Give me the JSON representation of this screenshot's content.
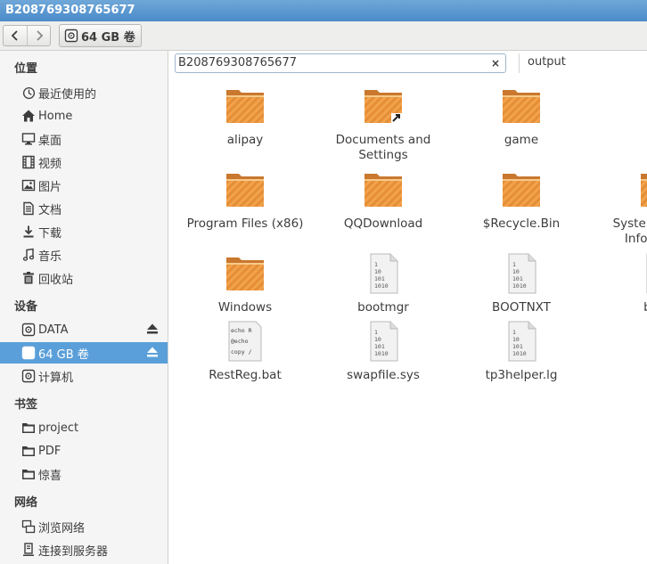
{
  "window": {
    "title": "B208769308765677"
  },
  "toolbar": {
    "back_icon": "chevron-left-icon",
    "forward_icon": "chevron-right-icon",
    "location_label": "64 GB 卷"
  },
  "sidebar": {
    "places_header": "位置",
    "places": [
      {
        "label": "最近使用的",
        "icon": "clock-icon"
      },
      {
        "label": "Home",
        "icon": "home-icon"
      },
      {
        "label": "桌面",
        "icon": "desktop-icon"
      },
      {
        "label": "视频",
        "icon": "film-icon"
      },
      {
        "label": "图片",
        "icon": "picture-icon"
      },
      {
        "label": "文档",
        "icon": "document-icon"
      },
      {
        "label": "下载",
        "icon": "download-icon"
      },
      {
        "label": "音乐",
        "icon": "music-icon"
      },
      {
        "label": "回收站",
        "icon": "trash-icon"
      }
    ],
    "devices_header": "设备",
    "devices": [
      {
        "label": "DATA",
        "icon": "drive-icon",
        "eject": true
      },
      {
        "label": "64 GB 卷",
        "icon": "drive-icon",
        "eject": true,
        "selected": true
      },
      {
        "label": "计算机",
        "icon": "drive-icon",
        "eject": false
      }
    ],
    "bookmarks_header": "书签",
    "bookmarks": [
      {
        "label": "project",
        "icon": "folder-icon"
      },
      {
        "label": "PDF",
        "icon": "folder-icon"
      },
      {
        "label": "惊喜",
        "icon": "folder-icon"
      }
    ],
    "network_header": "网络",
    "network": [
      {
        "label": "浏览网络",
        "icon": "network-icon"
      },
      {
        "label": "连接到服务器",
        "icon": "server-icon"
      }
    ]
  },
  "tabs": [
    {
      "label": "B208769308765677",
      "active": true,
      "close_label": "×"
    },
    {
      "label": "output",
      "active": false
    }
  ],
  "files": [
    {
      "name": "alipay",
      "type": "folder"
    },
    {
      "name": "Documents and Settings",
      "type": "folder-link"
    },
    {
      "name": "game",
      "type": "folder"
    },
    {
      "name": "Program Files (x86)",
      "type": "folder"
    },
    {
      "name": "QQDownload",
      "type": "folder"
    },
    {
      "name": "$Recycle.Bin",
      "type": "folder"
    },
    {
      "name": "System Volume Information",
      "type": "folder"
    },
    {
      "name": "Windows",
      "type": "folder"
    },
    {
      "name": "bootmgr",
      "type": "binary"
    },
    {
      "name": "BOOTNXT",
      "type": "binary"
    },
    {
      "name": "bssm",
      "type": "binary"
    },
    {
      "name": "RestReg.bat",
      "type": "script"
    },
    {
      "name": "swapfile.sys",
      "type": "binary"
    },
    {
      "name": "tp3helper.lg",
      "type": "binary"
    }
  ],
  "colors": {
    "selection": "#5a9fd9",
    "folder": "#f0a04b",
    "titlebar": "#4b8bc9"
  }
}
